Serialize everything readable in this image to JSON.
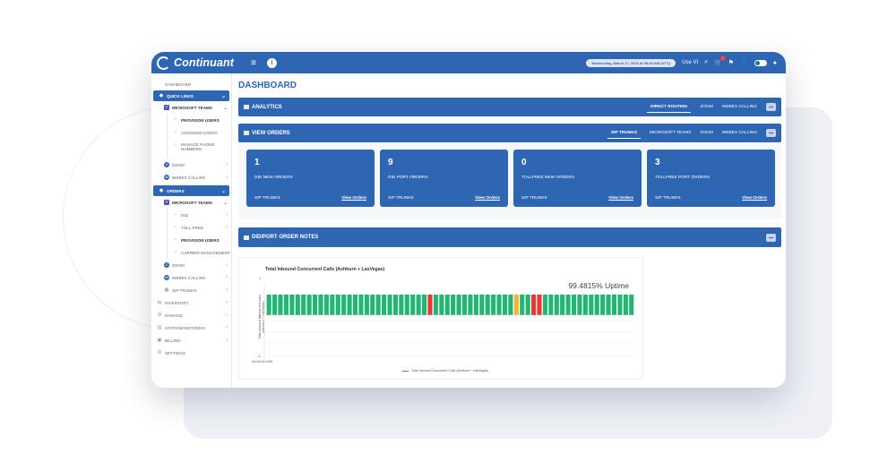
{
  "app": {
    "name": "Continuant"
  },
  "topbar": {
    "date_text": "Wednesday, March 17, 2021 at 09:44 AM (UTC)",
    "user": "Use VI",
    "notifications": "1"
  },
  "sidebar": {
    "dashboard": "DASHBOARD",
    "quick_links": "QUICK LINKS",
    "ms_teams": "MICROSOFT TEAMS",
    "provision_users": "PROVISION USERS",
    "assigned_users": "ASSIGNED USERS",
    "manage_phone_1": "MANAGE PHONE",
    "manage_phone_2": "NUMBERS",
    "zoom": "ZOOM",
    "webex": "WEBEX CALLING",
    "orders": "ORDERS",
    "ms_teams_2": "MICROSOFT TEAMS",
    "did": "DID",
    "tollfree": "TOLL-FREE",
    "provision_users_2": "PROVISION USERS",
    "carrier_mgmt": "CARRIER MANAGEMENT",
    "zoom_2": "ZOOM",
    "webex_2": "WEBEX CALLING",
    "sip_trunks": "SIP TRUNKS",
    "inventory": "INVENTORY",
    "manage": "MANAGE",
    "stats": "STATS/MONITORING",
    "billing": "BILLING",
    "settings": "SETTINGS"
  },
  "main": {
    "title": "DASHBOARD",
    "analytics": {
      "title": "ANALYTICS",
      "tabs": [
        "DIRECT ROUTING",
        "ZOOM",
        "WEBEX CALLING"
      ]
    },
    "view_orders": {
      "title": "VIEW ORDERS",
      "tabs": [
        "SIP TRUNKS",
        "MICROSOFT TEAMS",
        "ZOOM",
        "WEBEX CALLING"
      ]
    },
    "cards": [
      {
        "num": "1",
        "label": "DID NEW ORDERS",
        "foot": "SIP TRUNKS",
        "link": "View Orders"
      },
      {
        "num": "9",
        "label": "DID PORT ORDERS",
        "foot": "SIP TRUNKS",
        "link": "View Orders"
      },
      {
        "num": "0",
        "label": "TOLLFREE NEW ORDERS",
        "foot": "SIP TRUNKS",
        "link": "View Orders"
      },
      {
        "num": "3",
        "label": "TOLLFREE PORT ORDERS",
        "foot": "SIP TRUNKS",
        "link": "View Orders"
      }
    ],
    "notes": {
      "title": "DID/PORT ORDER NOTES"
    }
  },
  "colors": {
    "brand": "#2f66b3",
    "ok": "#22b573",
    "warn": "#f5b335",
    "bad": "#e53935"
  },
  "chart_data": {
    "type": "bar",
    "title": "Total Inbound Concurrent Calls (Ashburn + LasVegas)",
    "annotation": "99.4815% Uptime",
    "ylabel": "Total Inbound Concurrent Calls (Ashburn + LasVegas)",
    "y_ticks": [
      "1",
      "0",
      "-1"
    ],
    "x_ticks": [
      "04:00:00.000"
    ],
    "ylim": [
      -1,
      1
    ],
    "legend": "Total Inbound Concurrent Calls (Ashburn + LasVegas)",
    "status_legend_keys": [
      "ok",
      "warn",
      "bad"
    ],
    "status": [
      "ok",
      "ok",
      "ok",
      "ok",
      "ok",
      "ok",
      "ok",
      "ok",
      "ok",
      "ok",
      "ok",
      "ok",
      "ok",
      "ok",
      "ok",
      "ok",
      "ok",
      "ok",
      "ok",
      "ok",
      "ok",
      "ok",
      "ok",
      "ok",
      "ok",
      "ok",
      "ok",
      "ok",
      "bad",
      "ok",
      "ok",
      "ok",
      "ok",
      "ok",
      "ok",
      "ok",
      "ok",
      "ok",
      "ok",
      "ok",
      "ok",
      "ok",
      "ok",
      "warn",
      "ok",
      "ok",
      "bad",
      "bad",
      "ok",
      "ok",
      "ok",
      "ok",
      "ok",
      "ok",
      "ok",
      "ok",
      "ok",
      "ok",
      "ok",
      "ok",
      "ok",
      "ok",
      "ok",
      "ok"
    ]
  }
}
